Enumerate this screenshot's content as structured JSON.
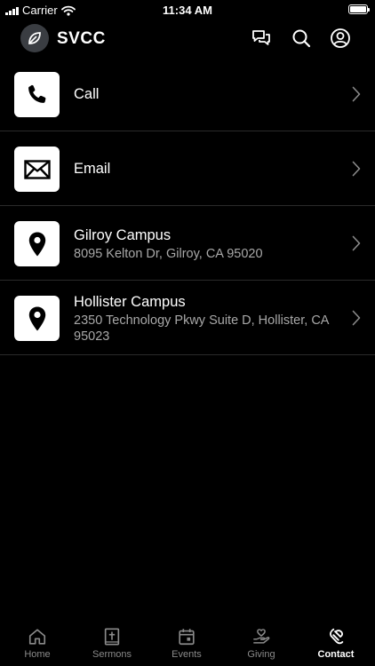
{
  "status_bar": {
    "carrier": "Carrier",
    "time": "11:34 AM"
  },
  "header": {
    "brand": "SVCC"
  },
  "contacts": [
    {
      "title": "Call",
      "subtitle": "",
      "icon": "phone-icon"
    },
    {
      "title": "Email",
      "subtitle": "",
      "icon": "envelope-icon"
    },
    {
      "title": "Gilroy Campus",
      "subtitle": "8095 Kelton Dr, Gilroy, CA 95020",
      "icon": "location-pin-icon"
    },
    {
      "title": "Hollister Campus",
      "subtitle": "2350 Technology Pkwy Suite D, Hollister, CA 95023",
      "icon": "location-pin-icon"
    }
  ],
  "tabs": [
    {
      "label": "Home",
      "icon": "home-icon"
    },
    {
      "label": "Sermons",
      "icon": "bible-icon"
    },
    {
      "label": "Events",
      "icon": "calendar-icon"
    },
    {
      "label": "Giving",
      "icon": "giving-hand-icon"
    },
    {
      "label": "Contact",
      "icon": "contact-icon",
      "active": true
    }
  ],
  "colors": {
    "background": "#000000",
    "text": "#ffffff",
    "secondary_text": "#a8a8a8",
    "divider": "#2a2a2a",
    "tab_inactive": "#8a8a8a"
  }
}
